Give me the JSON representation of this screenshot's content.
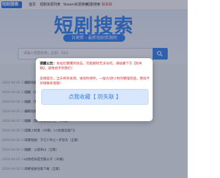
{
  "header": {
    "logo_text": "短剧搜索",
    "nav": [
      "首页",
      "短剧资源列表",
      "Steam资源搜索",
      "短剧搜索",
      "联系我"
    ]
  },
  "hero": {
    "title": "短剧搜索",
    "subtitle": "日更新 - 最新短剧资源网"
  },
  "search": {
    "placeholder": "请输入短剧名称，比如：XXX"
  },
  "list": {
    "rows": [
      {
        "date": "2024-04-26 13:32",
        "title": "最新短剧《十分危险的神秘人》"
      },
      {
        "date": "2024-04-26 13:32",
        "title": "短剧（女人一步落步）《女儿，我要你回来》"
      },
      {
        "date": "2024-04-26 13:31",
        "title": "短剧（男儿当自强）"
      },
      {
        "date": "2024-04-26 13:30",
        "title": "最新短剧更新：我的天后老婆2之绝世独宠（30集）"
      },
      {
        "date": "2024-04-26 13:29",
        "title": "短剧（我的女总裁老婆）（30集）"
      },
      {
        "date": "2024-04-26 13:28",
        "title": "首富小娇妻（30集）《小娇妻首富门》"
      },
      {
        "date": "2024-04-26 13:27",
        "title": "日更短剧：千亿少爷之一步登天（全集）"
      },
      {
        "date": "2024-04-26 13:26",
        "title": "短剧：父爱如山（全集）"
      },
      {
        "date": "2024-04-26 13:25",
        "title": "以为结局是无敌公子（30集）"
      },
      {
        "date": "2024-04-26 13:24",
        "title": "日更短剧合集下载（全集）"
      }
    ]
  },
  "modal": {
    "label": "提醒公告：",
    "text1": "本站近期遭到攻击，可能随时无法访问，请收藏下方【防失联】，避免找不到我们！",
    "text2": "友情提示，当天所有资源，请及时保存，一般为18小时内整理完成，若找不到请联系客服！",
    "button": "点我收藏【 防失联 】"
  },
  "colors": {
    "accent": "#3d8bf7",
    "notice_red": "#d32f2f",
    "cta_bg": "#d8e7fb"
  }
}
